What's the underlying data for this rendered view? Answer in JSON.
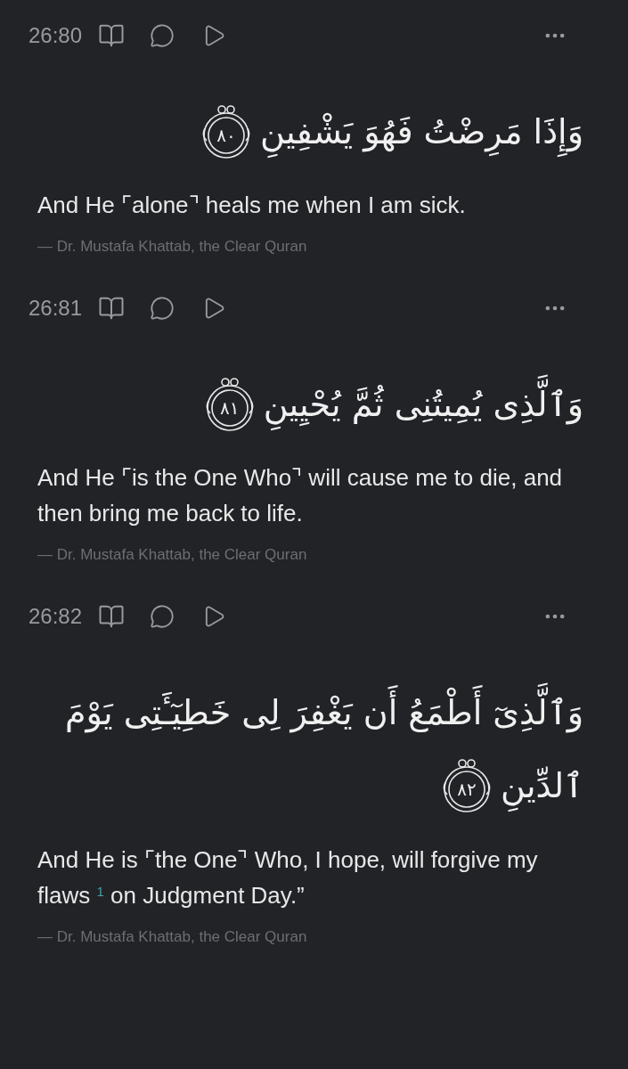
{
  "verses": [
    {
      "key": "26:80",
      "arabic": [
        "وَإِذَا مَرِضْتُ فَهُوَ يَشْفِينِ"
      ],
      "number": "٨٠",
      "translation": "And He ⌜alone⌝ heals me when I am sick.",
      "attribution": "— Dr. Mustafa Khattab, the Clear Quran"
    },
    {
      "key": "26:81",
      "arabic": [
        "وَٱلَّذِى يُمِيتُنِى ثُمَّ يُحْيِينِ"
      ],
      "number": "٨١",
      "translation": "And He ⌜is the One Who⌝ will cause me to die, and then bring me back to life.",
      "attribution": "— Dr. Mustafa Khattab, the Clear Quran"
    },
    {
      "key": "26:82",
      "arabic": [
        "وَٱلَّذِىٓ أَطْمَعُ أَن يَغْفِرَ لِى خَطِيٓـَٔتِى يَوْمَ",
        "ٱلدِّينِ"
      ],
      "number": "٨٢",
      "translation": "And He is ⌜the One⌝ Who, I hope, will forgive my flaws $^{1}$ on Judgment Day.”",
      "attribution": "— Dr. Mustafa Khattab, the Clear Quran"
    }
  ]
}
